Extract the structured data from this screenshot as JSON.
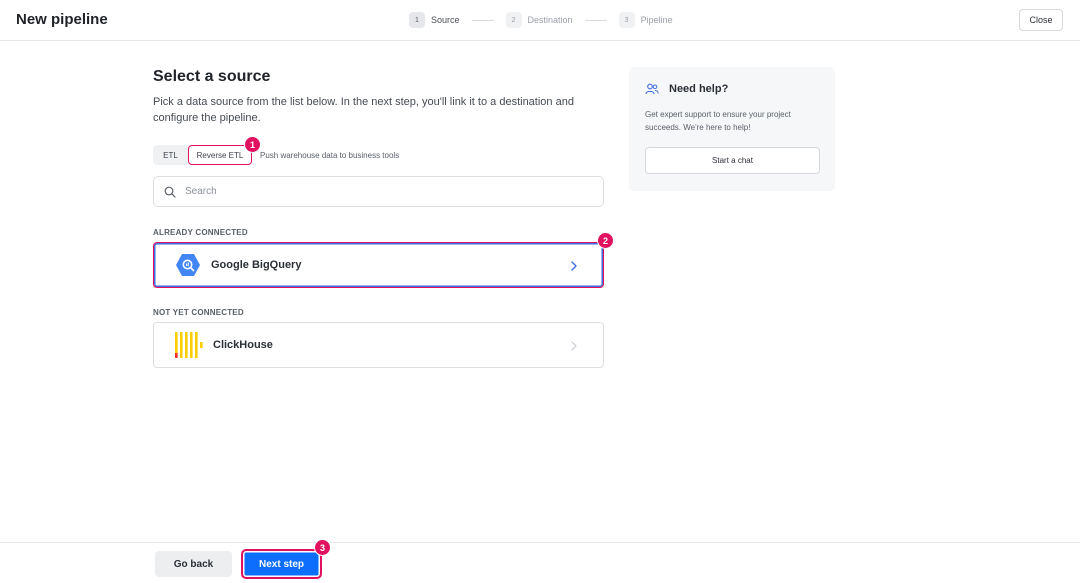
{
  "header": {
    "title": "New pipeline",
    "steps": [
      {
        "number": "1",
        "label": "Source"
      },
      {
        "number": "2",
        "label": "Destination"
      },
      {
        "number": "3",
        "label": "Pipeline"
      }
    ],
    "close_label": "Close"
  },
  "main": {
    "heading": "Select a source",
    "description": "Pick a data source from the list below. In the next step, you'll link it to a destination and configure the pipeline.",
    "tabs": [
      {
        "label": "ETL"
      },
      {
        "label": "Reverse ETL"
      }
    ],
    "tab_description": "Push warehouse data to business tools",
    "search": {
      "placeholder": "Search",
      "value": ""
    },
    "sections": {
      "connected_label": "ALREADY CONNECTED",
      "not_connected_label": "NOT YET CONNECTED"
    },
    "sources": {
      "connected": [
        {
          "name": "Google BigQuery",
          "icon": "bigquery-icon"
        }
      ],
      "not_connected": [
        {
          "name": "ClickHouse",
          "icon": "clickhouse-icon"
        }
      ]
    }
  },
  "help": {
    "title": "Need help?",
    "text": "Get expert support to ensure your project succeeds. We're here to help!",
    "button_label": "Start a chat"
  },
  "footer": {
    "back_label": "Go back",
    "next_label": "Next step"
  },
  "annotations": [
    "1",
    "2",
    "3"
  ],
  "colors": {
    "accent_blue": "#0d6efd",
    "highlight_pink": "#e0125f",
    "bigquery_blue": "#4285f4",
    "clickhouse_yellow": "#fcce00",
    "clickhouse_red": "#ff2b2b"
  }
}
